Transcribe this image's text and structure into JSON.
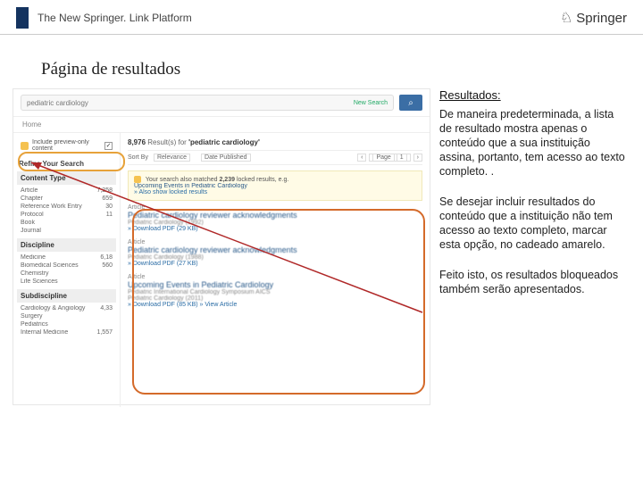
{
  "header": {
    "title": "The New Springer. Link Platform",
    "logo": "Springer"
  },
  "page": {
    "title": "Página de resultados"
  },
  "explain": {
    "heading": "Resultados:",
    "p1": "De maneira predeterminada, a lista de resultado mostra apenas o conteúdo que a sua instituição assina, portanto, tem acesso ao texto completo. .",
    "p2": "Se desejar incluir resultados do conteúdo que a instituição não tem acesso ao texto completo, marcar esta opção, no cadeado amarelo.",
    "p3": "Feito isto, os resultados bloqueados também serão apresentados."
  },
  "sp": {
    "search_value": "pediatric cardiology",
    "search_badge": "New Search",
    "home": "Home",
    "preview_label": "Include preview-only content",
    "refine": "Refine Your Search",
    "stats_count": "8,976",
    "stats_label": "Result(s) for",
    "stats_query": "'pediatric cardiology'",
    "sort_label": "Sort By",
    "sort_value": "Relevance",
    "date_label": "Date Published",
    "page_label": "Page",
    "page_num": "1",
    "notice_a": "Your search also matched",
    "notice_count": "2,239",
    "notice_b": "locked results, e.g.",
    "notice_example": "Upcoming Events in Pediatric Cardiology",
    "notice_link": "» Also show locked results",
    "facets": {
      "contentType": {
        "head": "Content Type",
        "rows": [
          {
            "k": "Article",
            "v": "7,258"
          },
          {
            "k": "Chapter",
            "v": "659"
          },
          {
            "k": "Reference Work Entry",
            "v": "30"
          },
          {
            "k": "Protocol",
            "v": "11"
          },
          {
            "k": "Book",
            "v": ""
          },
          {
            "k": "Journal",
            "v": ""
          }
        ]
      },
      "discipline": {
        "head": "Discipline",
        "rows": [
          {
            "k": "Medicine",
            "v": "6,18"
          },
          {
            "k": "Biomedical Sciences",
            "v": "560"
          },
          {
            "k": "Chemistry",
            "v": ""
          },
          {
            "k": "Life Sciences",
            "v": ""
          }
        ]
      },
      "subdiscipline": {
        "head": "Subdiscipline",
        "rows": [
          {
            "k": "Cardiology & Angiology",
            "v": "4,33"
          },
          {
            "k": "Surgery",
            "v": ""
          },
          {
            "k": "Pediatrics",
            "v": ""
          },
          {
            "k": "Internal Medicine",
            "v": "1,557"
          }
        ]
      }
    },
    "results": [
      {
        "type": "Article",
        "title": "Pediatric cardiology reviewer acknowledgments",
        "meta": "Pediatric Cardiology (1992)",
        "dl": "» Download PDF (29 KB)"
      },
      {
        "type": "Article",
        "title": "Pediatric cardiology reviewer acknowledgments",
        "meta": "Pediatric Cardiology (1988)",
        "dl": "» Download PDF (27 KB)"
      },
      {
        "type": "Article",
        "title": "Upcoming Events in Pediatric Cardiology",
        "meta": "Pediatric International Cardiology Symposium AICS",
        "meta2": "Pediatric Cardiology (2011)",
        "dl": "» Download PDF (85 KB)   » View Article"
      }
    ]
  }
}
